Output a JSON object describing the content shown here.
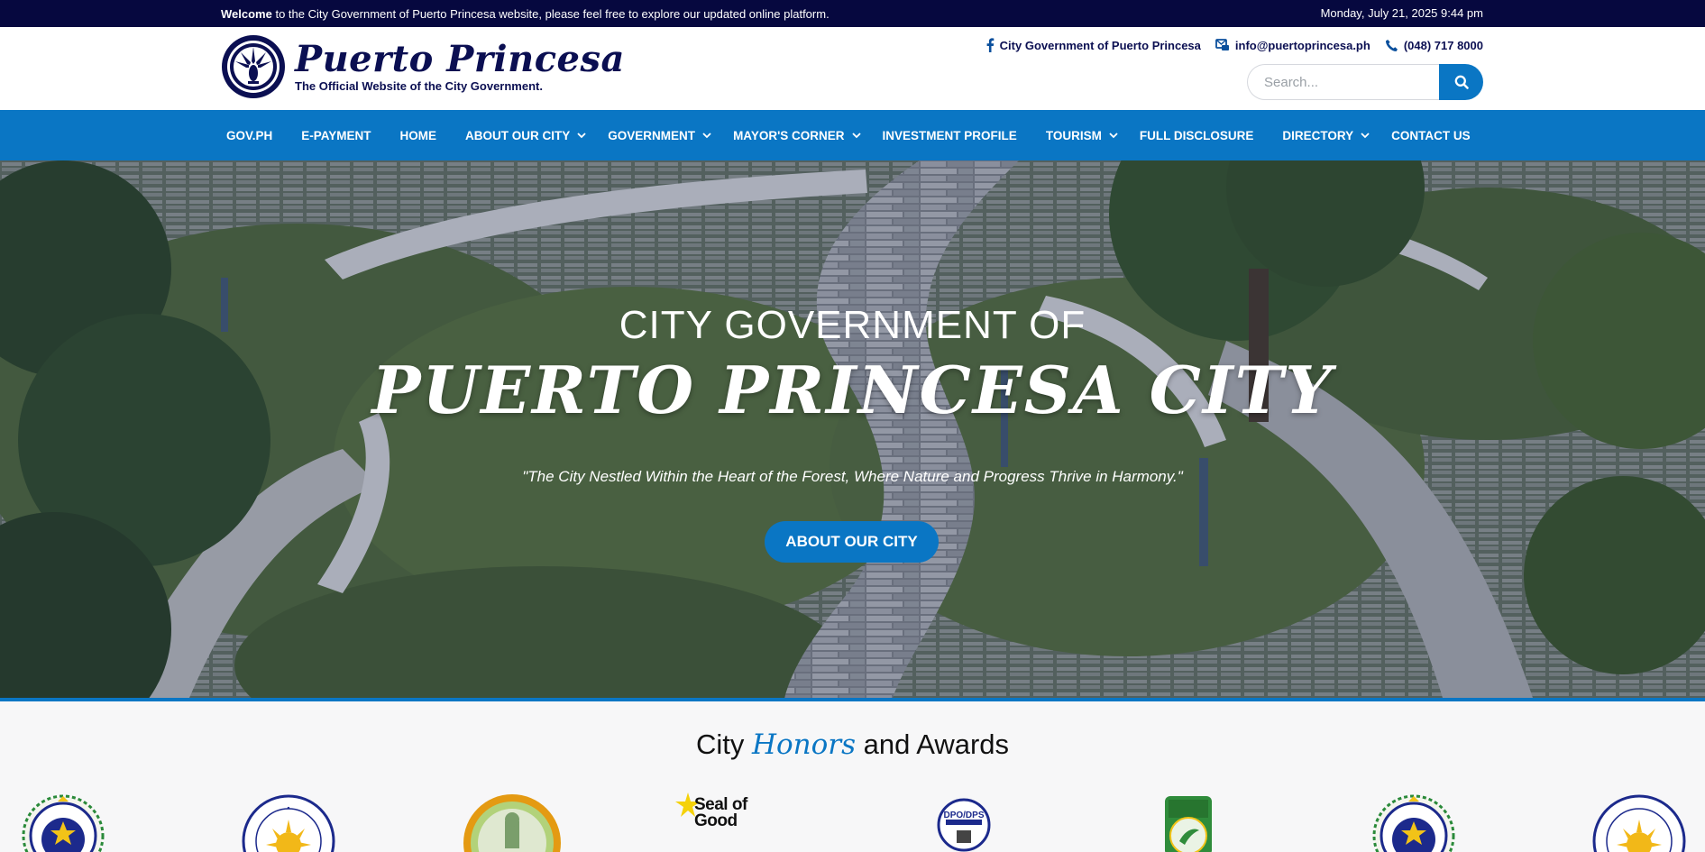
{
  "topbar": {
    "welcome_bold": "Welcome",
    "welcome_rest": " to the City Government of Puerto Princesa website, please feel free to explore our updated online platform.",
    "datetime": "Monday, July 21, 2025 9:44 pm"
  },
  "header": {
    "brand_name": "Puerto Princesa",
    "brand_tagline": "The Official Website of the City Government.",
    "contacts": {
      "facebook": "City Government of Puerto Princesa",
      "email": "info@puertoprincesa.ph",
      "phone": "(048) 717 8000"
    },
    "search": {
      "placeholder": "Search..."
    }
  },
  "nav": {
    "items": [
      {
        "label": "GOV.PH",
        "has_dropdown": false
      },
      {
        "label": "E-PAYMENT",
        "has_dropdown": false
      },
      {
        "label": "HOME",
        "has_dropdown": false
      },
      {
        "label": "ABOUT OUR CITY",
        "has_dropdown": true
      },
      {
        "label": "GOVERNMENT",
        "has_dropdown": true
      },
      {
        "label": "MAYOR'S CORNER",
        "has_dropdown": true
      },
      {
        "label": "INVESTMENT PROFILE",
        "has_dropdown": false
      },
      {
        "label": "TOURISM",
        "has_dropdown": true
      },
      {
        "label": "FULL DISCLOSURE",
        "has_dropdown": false
      },
      {
        "label": "DIRECTORY",
        "has_dropdown": true
      },
      {
        "label": "CONTACT US",
        "has_dropdown": false
      }
    ]
  },
  "hero": {
    "kicker": "CITY GOVERNMENT OF",
    "title": "PUERTO PRINCESA CITY",
    "quote": "\"The City Nestled Within the Heart of the Forest, Where Nature and Progress Thrive in Harmony.\"",
    "button_label": "ABOUT OUR CITY"
  },
  "honors": {
    "title_before": "City ",
    "title_accent": "Honors",
    "title_after": " and Awards",
    "seal_text": "Seal of Good"
  },
  "colors": {
    "topbar_bg": "#06083f",
    "brand_navy": "#0b0f52",
    "accent_blue": "#0a76c4"
  }
}
